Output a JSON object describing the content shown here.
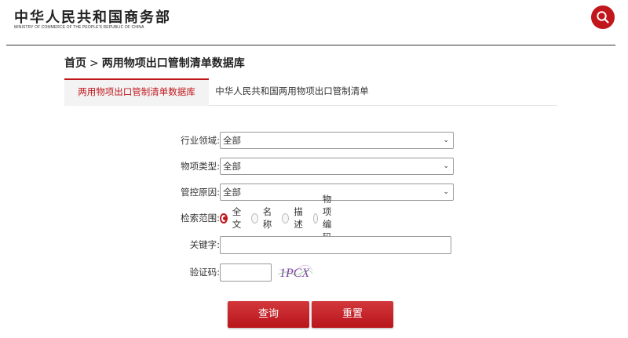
{
  "header": {
    "logo_cn": "中华人民共和国商务部",
    "logo_en": "MINISTRY OF COMMERCE OF THE PEOPLE'S REPUBLIC OF CHINA"
  },
  "breadcrumb": {
    "home": "首页",
    "separator": ">",
    "current": "两用物项出口管制清单数据库"
  },
  "tabs": [
    {
      "label": "两用物项出口管制清单数据库",
      "active": true
    },
    {
      "label": "中华人民共和国两用物项出口管制清单",
      "active": false
    }
  ],
  "form": {
    "industry": {
      "label": "行业领域:",
      "value": "全部"
    },
    "item_type": {
      "label": "物项类型:",
      "value": "全部"
    },
    "control_reason": {
      "label": "管控原因:",
      "value": "全部"
    },
    "scope": {
      "label": "检索范围:",
      "options": [
        {
          "label": "全文",
          "selected": true
        },
        {
          "label": "名称",
          "selected": false
        },
        {
          "label": "描述",
          "selected": false
        },
        {
          "label": "物项编码",
          "selected": false
        }
      ]
    },
    "keyword": {
      "label": "关键字:",
      "value": ""
    },
    "captcha": {
      "label": "验证码:",
      "value": "",
      "image_text": "1PCX"
    }
  },
  "buttons": {
    "query": "查询",
    "reset": "重置"
  },
  "colors": {
    "brand_red": "#c1161c"
  }
}
